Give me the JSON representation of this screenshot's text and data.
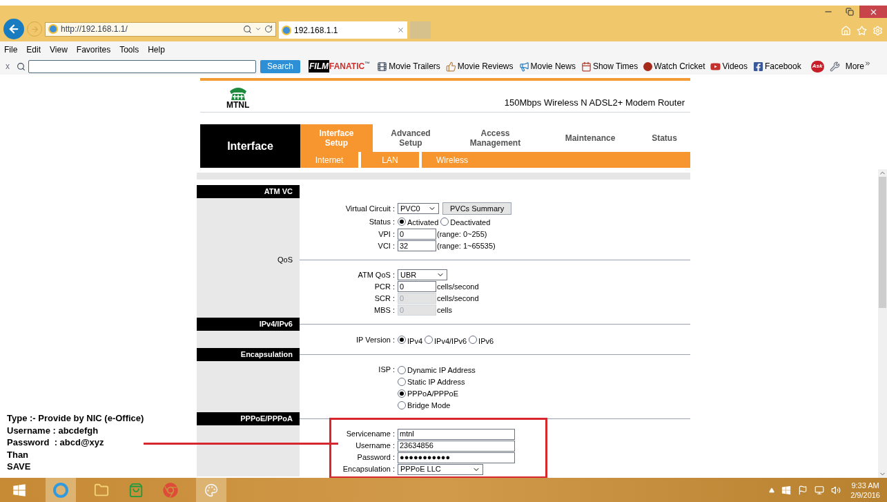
{
  "browser": {
    "address": "http://192.168.1.1/",
    "tab": {
      "title": "192.168.1.1"
    },
    "menu": [
      "File",
      "Edit",
      "View",
      "Favorites",
      "Tools",
      "Help"
    ],
    "toolbar": {
      "close": "x",
      "search_button": "Search",
      "brand": {
        "mark": "FILM",
        "name": "FANATIC",
        "tm": "™"
      },
      "links": [
        {
          "kind": "film",
          "label": "Movie Trailers"
        },
        {
          "kind": "thumb",
          "label": "Movie Reviews"
        },
        {
          "kind": "megaphone",
          "label": "Movie News"
        },
        {
          "kind": "calendar",
          "label": "Show Times"
        },
        {
          "kind": "ball",
          "label": "Watch Cricket"
        },
        {
          "kind": "video",
          "label": "Videos"
        },
        {
          "kind": "facebook",
          "label": "Facebook"
        }
      ],
      "ask": "Ask",
      "more": "More"
    }
  },
  "router": {
    "logo": "MTNL",
    "model": "150Mbps Wireless N ADSL2+ Modem Router",
    "area": "Interface",
    "tabs": [
      {
        "label": "Interface Setup",
        "selected": true
      },
      {
        "label": "Advanced Setup",
        "selected": false
      },
      {
        "label": "Access Management",
        "selected": false
      },
      {
        "label": "Maintenance",
        "selected": false
      },
      {
        "label": "Status",
        "selected": false
      }
    ],
    "subtabs": [
      "Internet",
      "LAN",
      "Wireless"
    ],
    "sections": [
      {
        "title": "ATM VC",
        "kind": "header",
        "rule": false,
        "rows": [
          {
            "kind": "select",
            "label": "Virtual Circuit :",
            "value": "PVC0",
            "button": "PVCs Summary"
          },
          {
            "kind": "radio",
            "label": "Status :",
            "options": [
              {
                "label": "Activated",
                "selected": true
              },
              {
                "label": "Deactivated",
                "selected": false
              }
            ]
          },
          {
            "kind": "input",
            "label": "VPI :",
            "value": "0",
            "note": "(range: 0~255)",
            "disabled": false
          },
          {
            "kind": "input",
            "label": "VCI :",
            "value": "32",
            "note": "(range: 1~65535)",
            "disabled": false
          }
        ]
      },
      {
        "title": "QoS",
        "kind": "subheader",
        "rule": true,
        "rows": [
          {
            "kind": "select",
            "label": "ATM QoS :",
            "value": "UBR"
          },
          {
            "kind": "input",
            "label": "PCR :",
            "value": "0",
            "note": "cells/second",
            "disabled": false
          },
          {
            "kind": "input",
            "label": "SCR :",
            "value": "0",
            "note": "cells/second",
            "disabled": true
          },
          {
            "kind": "input",
            "label": "MBS :",
            "value": "0",
            "note": "cells",
            "disabled": true
          }
        ]
      },
      {
        "title": "IPv4/IPv6",
        "kind": "header",
        "rule": true,
        "rows": [
          {
            "kind": "radio",
            "label": "IP Version :",
            "options": [
              {
                "label": "IPv4",
                "selected": true
              },
              {
                "label": "IPv4/IPv6",
                "selected": false
              },
              {
                "label": "IPv6",
                "selected": false
              }
            ]
          }
        ]
      },
      {
        "title": "Encapsulation",
        "kind": "header",
        "rule": true,
        "rows": [
          {
            "kind": "radiolist",
            "label": "ISP :",
            "options": [
              {
                "label": "Dynamic IP Address",
                "selected": false
              },
              {
                "label": "Static IP Address",
                "selected": false
              },
              {
                "label": "PPPoA/PPPoE",
                "selected": true
              },
              {
                "label": "Bridge Mode",
                "selected": false
              }
            ]
          }
        ]
      },
      {
        "title": "PPPoE/PPPoA",
        "kind": "header",
        "rule": true,
        "rows": [
          {
            "kind": "input",
            "label": "Servicename :",
            "value": "mtnl",
            "disabled": false
          },
          {
            "kind": "input",
            "label": "Username :",
            "value": "23634856",
            "disabled": false
          },
          {
            "kind": "input",
            "label": "Password :",
            "value": "●●●●●●●●●●●",
            "disabled": false
          },
          {
            "kind": "select",
            "label": "Encapsulation :",
            "value": "PPPoE LLC"
          }
        ]
      }
    ]
  },
  "annotation": {
    "lines": [
      "Type :- Provide by NIC (e-Office)",
      "Username : abcdefgh",
      "Password  : abcd@xyz",
      "Than",
      "SAVE"
    ]
  },
  "taskbar": {
    "time": "9:33 AM",
    "date": "2/9/2016"
  }
}
